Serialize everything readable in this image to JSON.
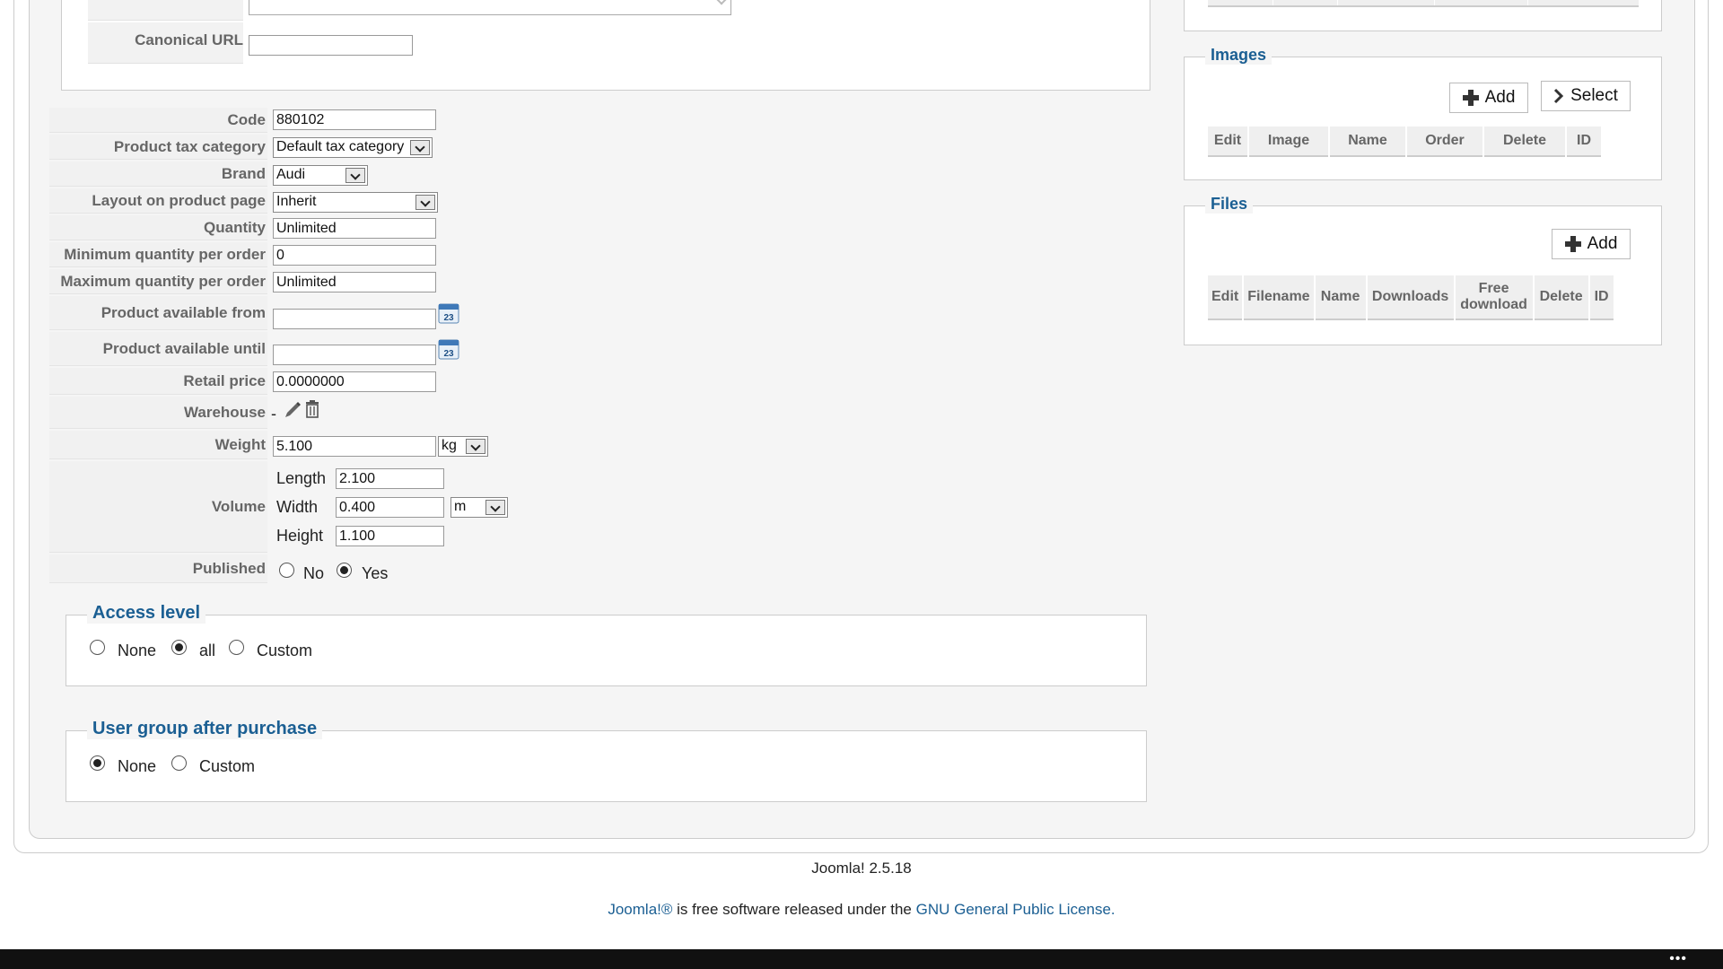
{
  "metadata": {
    "canonical_label": "Canonical URL",
    "canonical_value": ""
  },
  "form": {
    "code": {
      "label": "Code",
      "value": "880102"
    },
    "tax_category": {
      "label": "Product tax category",
      "value": "Default tax category"
    },
    "brand": {
      "label": "Brand",
      "value": "Audi"
    },
    "layout": {
      "label": "Layout on product page",
      "value": "Inherit"
    },
    "quantity": {
      "label": "Quantity",
      "value": "Unlimited"
    },
    "min_qty": {
      "label": "Minimum quantity per order",
      "value": "0"
    },
    "max_qty": {
      "label": "Maximum quantity per order",
      "value": "Unlimited"
    },
    "available_from": {
      "label": "Product available from",
      "value": ""
    },
    "available_until": {
      "label": "Product available until",
      "value": ""
    },
    "retail_price": {
      "label": "Retail price",
      "value": "0.0000000"
    },
    "warehouse": {
      "label": "Warehouse",
      "value": "-"
    },
    "weight": {
      "label": "Weight",
      "value": "5.100",
      "unit": "kg"
    },
    "volume": {
      "label": "Volume",
      "length_label": "Length",
      "length": "2.100",
      "width_label": "Width",
      "width": "0.400",
      "height_label": "Height",
      "height": "1.100",
      "unit": "m"
    },
    "published": {
      "label": "Published",
      "no": "No",
      "yes": "Yes",
      "selected": "yes"
    }
  },
  "access_level": {
    "legend": "Access level",
    "options": [
      "None",
      "all",
      "Custom"
    ],
    "selected": "all"
  },
  "user_group": {
    "legend": "User group after purchase",
    "options": [
      "None",
      "Custom"
    ],
    "selected": "None"
  },
  "images": {
    "legend": "Images",
    "add_label": "Add",
    "select_label": "Select",
    "columns": [
      "Edit",
      "Image",
      "Name",
      "Order",
      "Delete",
      "ID"
    ]
  },
  "files": {
    "legend": "Files",
    "add_label": "Add",
    "columns": [
      "Edit",
      "Filename",
      "Name",
      "Downloads",
      "Free download",
      "Delete",
      "ID"
    ]
  },
  "footer": {
    "version": "Joomla! 2.5.18",
    "license_link1": "Joomla!®",
    "license_mid": " is free software released under the ",
    "license_link2": "GNU General Public License."
  },
  "taskbar": {
    "dots": "•••"
  },
  "colors": {
    "legend": "#1b5f93",
    "label": "#666666",
    "panel": "#f5f5f5"
  }
}
